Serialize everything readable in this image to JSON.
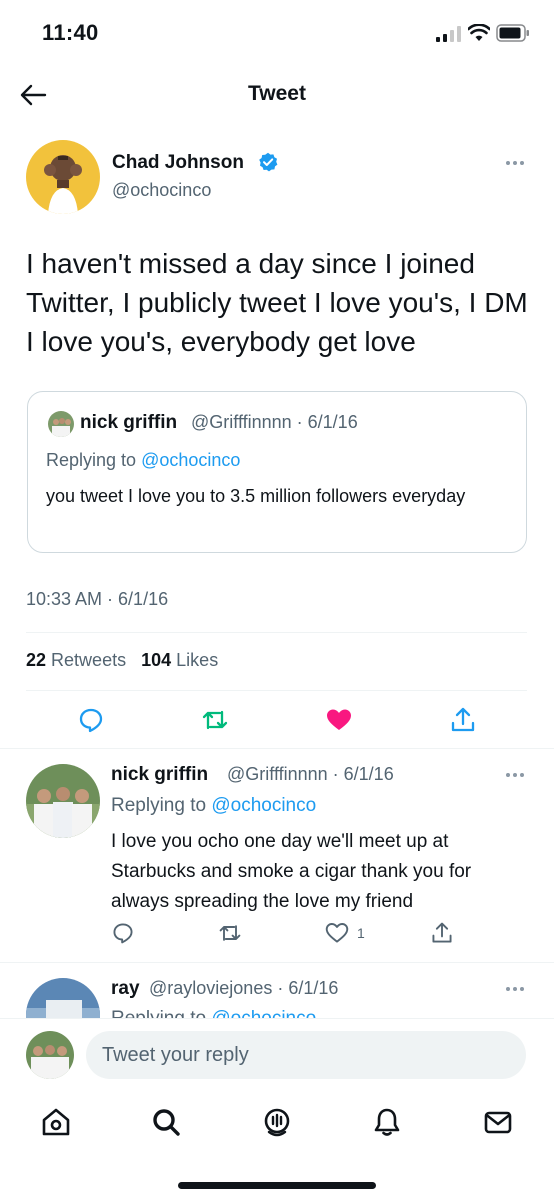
{
  "status_bar": {
    "time": "11:40"
  },
  "header": {
    "title": "Tweet"
  },
  "tweet": {
    "author_name": "Chad Johnson",
    "author_handle": "@ochocinco",
    "text": "I haven't missed a day since I joined Twitter, I publicly tweet I love you's, I DM I love you's, everybody get love",
    "timestamp": "10:33 AM · 6/1/16",
    "retweet_count": "22",
    "retweet_label": "Retweets",
    "like_count": "104",
    "like_label": "Likes"
  },
  "quoted_tweet": {
    "author_name": "nick griffin",
    "author_handle_date": "@Grifffinnnn · 6/1/16",
    "replying_prefix": "Replying to ",
    "replying_handle": "@ochocinco",
    "text": "you tweet I love you to 3.5 million followers everyday"
  },
  "replies": [
    {
      "author_name": "nick griffin",
      "author_handle_date": "@Grifffinnnn · 6/1/16",
      "replying_prefix": "Replying to ",
      "replying_handle": "@ochocinco",
      "text": "I love you ocho one day we'll meet up at Starbucks and smoke a cigar thank you for always spreading the love my friend",
      "like_count": "1"
    },
    {
      "author_name": "ray",
      "author_handle_date": "@rayloviejones · 6/1/16",
      "replying_prefix": "Replying to ",
      "replying_handle": "@ochocinco"
    }
  ],
  "compose": {
    "placeholder": "Tweet your reply"
  },
  "tabs": [
    "home-icon",
    "search-icon",
    "spaces-icon",
    "notifications-icon",
    "messages-icon"
  ],
  "colors": {
    "accent": "#1d9bf0",
    "like": "#f91880",
    "retweet": "#00ba7c",
    "text": "#0f1419",
    "muted": "#536471"
  }
}
